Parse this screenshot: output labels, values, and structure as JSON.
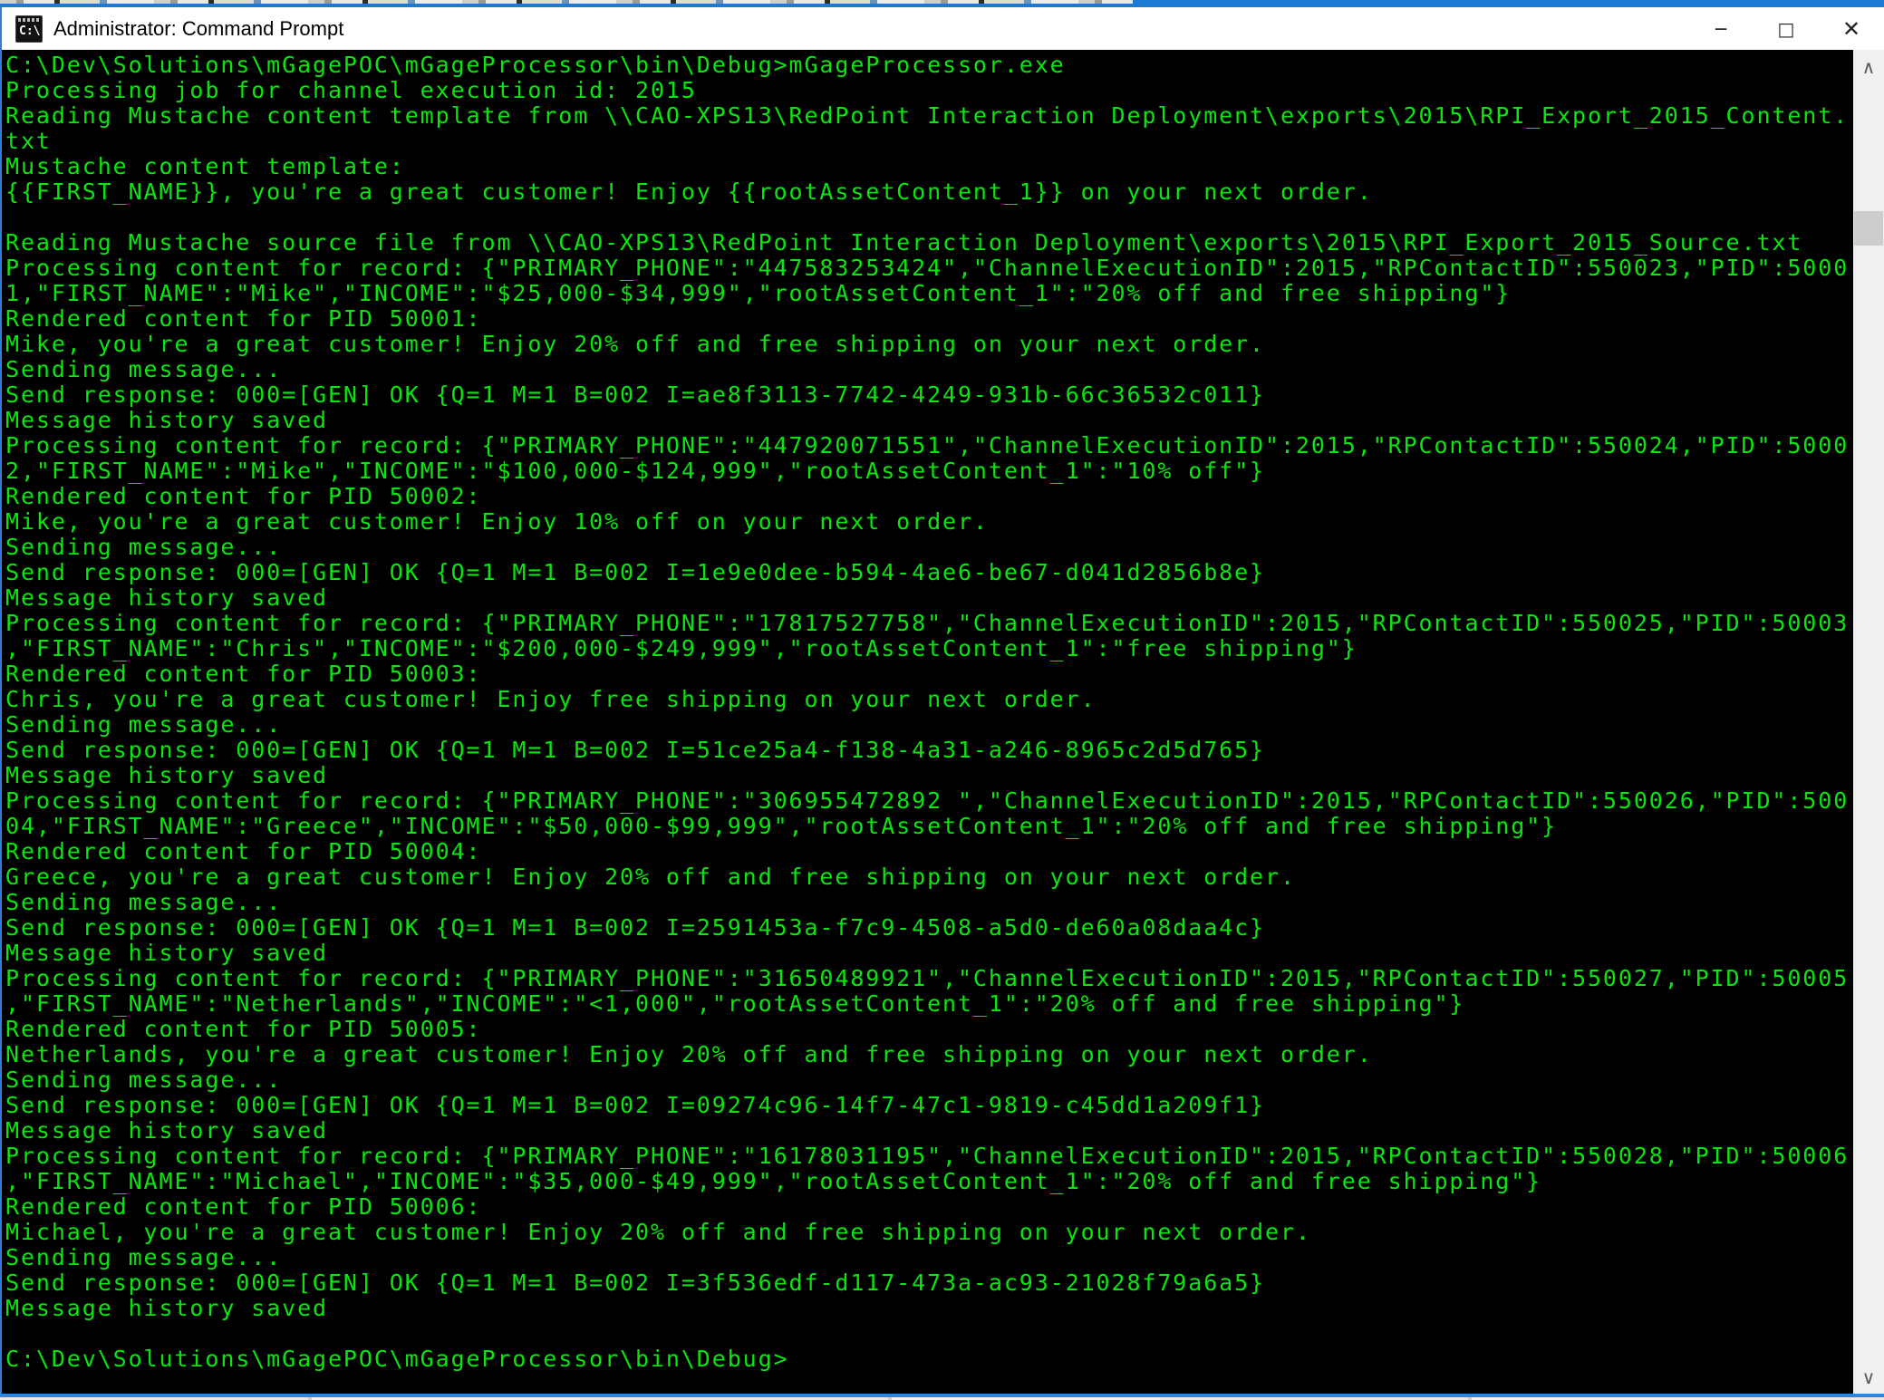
{
  "window": {
    "title": "Administrator: Command Prompt",
    "icon_label": "C:\\",
    "controls": {
      "minimize": "─",
      "maximize": "□",
      "close": "✕"
    }
  },
  "colors": {
    "console_background": "#000000",
    "console_text_green": "#0ae50f",
    "titlebar_background": "#ffffff",
    "accent_border_blue": "#2f7fd6",
    "scrollbar_track": "#f0f0f0",
    "scrollbar_thumb": "#cdcdcd"
  },
  "scrollbar": {
    "up_arrow": "∧",
    "down_arrow": "∨"
  },
  "console": {
    "lines": [
      "C:\\Dev\\Solutions\\mGagePOC\\mGageProcessor\\bin\\Debug>mGageProcessor.exe",
      "Processing job for channel execution id: 2015",
      "Reading Mustache content template from \\\\CAO-XPS13\\RedPoint Interaction Deployment\\exports\\2015\\RPI_Export_2015_Content.",
      "txt",
      "Mustache content template:",
      "{{FIRST_NAME}}, you're a great customer! Enjoy {{rootAssetContent_1}} on your next order.",
      "",
      "Reading Mustache source file from \\\\CAO-XPS13\\RedPoint Interaction Deployment\\exports\\2015\\RPI_Export_2015_Source.txt",
      "Processing content for record: {\"PRIMARY_PHONE\":\"447583253424\",\"ChannelExecutionID\":2015,\"RPContactID\":550023,\"PID\":5000",
      "1,\"FIRST_NAME\":\"Mike\",\"INCOME\":\"$25,000-$34,999\",\"rootAssetContent_1\":\"20% off and free shipping\"}",
      "Rendered content for PID 50001:",
      "Mike, you're a great customer! Enjoy 20% off and free shipping on your next order.",
      "Sending message...",
      "Send response: 000=[GEN] OK {Q=1 M=1 B=002 I=ae8f3113-7742-4249-931b-66c36532c011}",
      "Message history saved",
      "Processing content for record: {\"PRIMARY_PHONE\":\"447920071551\",\"ChannelExecutionID\":2015,\"RPContactID\":550024,\"PID\":5000",
      "2,\"FIRST_NAME\":\"Mike\",\"INCOME\":\"$100,000-$124,999\",\"rootAssetContent_1\":\"10% off\"}",
      "Rendered content for PID 50002:",
      "Mike, you're a great customer! Enjoy 10% off on your next order.",
      "Sending message...",
      "Send response: 000=[GEN] OK {Q=1 M=1 B=002 I=1e9e0dee-b594-4ae6-be67-d041d2856b8e}",
      "Message history saved",
      "Processing content for record: {\"PRIMARY_PHONE\":\"17817527758\",\"ChannelExecutionID\":2015,\"RPContactID\":550025,\"PID\":50003",
      ",\"FIRST_NAME\":\"Chris\",\"INCOME\":\"$200,000-$249,999\",\"rootAssetContent_1\":\"free shipping\"}",
      "Rendered content for PID 50003:",
      "Chris, you're a great customer! Enjoy free shipping on your next order.",
      "Sending message...",
      "Send response: 000=[GEN] OK {Q=1 M=1 B=002 I=51ce25a4-f138-4a31-a246-8965c2d5d765}",
      "Message history saved",
      "Processing content for record: {\"PRIMARY_PHONE\":\"306955472892 \",\"ChannelExecutionID\":2015,\"RPContactID\":550026,\"PID\":500",
      "04,\"FIRST_NAME\":\"Greece\",\"INCOME\":\"$50,000-$99,999\",\"rootAssetContent_1\":\"20% off and free shipping\"}",
      "Rendered content for PID 50004:",
      "Greece, you're a great customer! Enjoy 20% off and free shipping on your next order.",
      "Sending message...",
      "Send response: 000=[GEN] OK {Q=1 M=1 B=002 I=2591453a-f7c9-4508-a5d0-de60a08daa4c}",
      "Message history saved",
      "Processing content for record: {\"PRIMARY_PHONE\":\"31650489921\",\"ChannelExecutionID\":2015,\"RPContactID\":550027,\"PID\":50005",
      ",\"FIRST_NAME\":\"Netherlands\",\"INCOME\":\"<1,000\",\"rootAssetContent_1\":\"20% off and free shipping\"}",
      "Rendered content for PID 50005:",
      "Netherlands, you're a great customer! Enjoy 20% off and free shipping on your next order.",
      "Sending message...",
      "Send response: 000=[GEN] OK {Q=1 M=1 B=002 I=09274c96-14f7-47c1-9819-c45dd1a209f1}",
      "Message history saved",
      "Processing content for record: {\"PRIMARY_PHONE\":\"16178031195\",\"ChannelExecutionID\":2015,\"RPContactID\":550028,\"PID\":50006",
      ",\"FIRST_NAME\":\"Michael\",\"INCOME\":\"$35,000-$49,999\",\"rootAssetContent_1\":\"20% off and free shipping\"}",
      "Rendered content for PID 50006:",
      "Michael, you're a great customer! Enjoy 20% off and free shipping on your next order.",
      "Sending message...",
      "Send response: 000=[GEN] OK {Q=1 M=1 B=002 I=3f536edf-d117-473a-ac93-21028f79a6a5}",
      "Message history saved",
      "",
      "C:\\Dev\\Solutions\\mGagePOC\\mGageProcessor\\bin\\Debug>"
    ]
  }
}
